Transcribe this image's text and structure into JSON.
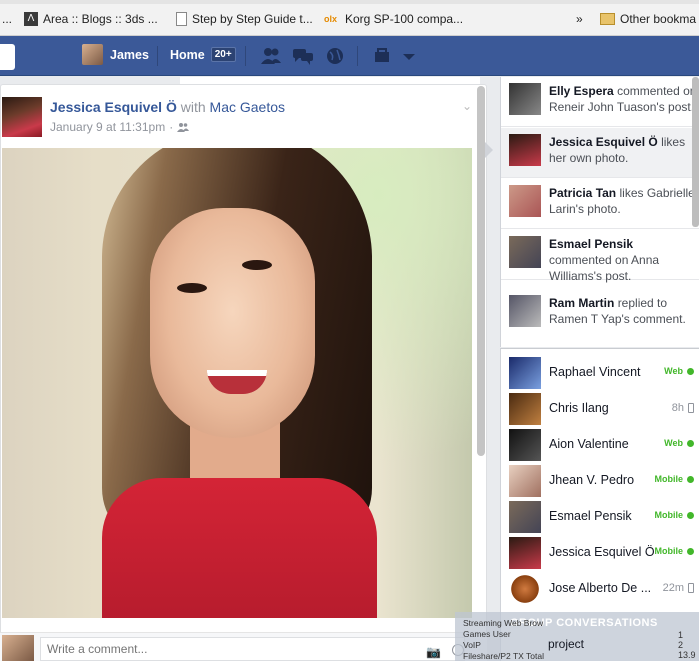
{
  "bookmarks": {
    "items": [
      {
        "label": "..."
      },
      {
        "label": "Area :: Blogs :: 3ds ..."
      },
      {
        "label": "Step by Step Guide t..."
      },
      {
        "label": "Korg SP-100 compa..."
      }
    ],
    "overflow": "»",
    "other": "Other bookma"
  },
  "topbar": {
    "user_name": "James",
    "home_label": "Home",
    "home_badge": "20+",
    "colors": {
      "brand": "#3b5998"
    }
  },
  "post": {
    "author": "Jessica Esquivel Ö",
    "with_text": "with",
    "tagged": "Mac Gaetos",
    "date": "January 9 at 11:31pm",
    "separator": "·",
    "audience_icon": "friends-icon"
  },
  "comment": {
    "placeholder": "Write a comment..."
  },
  "ticker": [
    {
      "name": "Elly Espera",
      "text": "commented on Reneir John Tuason's post."
    },
    {
      "name": "Jessica Esquivel Ö",
      "text": "likes her own photo."
    },
    {
      "name": "Patricia Tan",
      "text": "likes Gabrielle Larin's photo."
    },
    {
      "name": "Esmael Pensik",
      "text": "commented on Anna Williams's post."
    },
    {
      "name": "Ram Martin",
      "text": "replied to Ramen T Yap's comment."
    }
  ],
  "chat": [
    {
      "name": "Raphael Vincent",
      "status": "Web",
      "kind": "web"
    },
    {
      "name": "Chris Ilang",
      "status": "8h",
      "kind": "time"
    },
    {
      "name": "Aion Valentine",
      "status": "Web",
      "kind": "web"
    },
    {
      "name": "Jhean V. Pedro",
      "status": "Mobile",
      "kind": "mobile"
    },
    {
      "name": "Esmael Pensik",
      "status": "Mobile",
      "kind": "mobile"
    },
    {
      "name": "Jessica Esquivel Ö",
      "status": "Mobile",
      "kind": "mobile"
    },
    {
      "name": "Jose Alberto De ...",
      "status": "22m",
      "kind": "time"
    }
  ],
  "overlay": {
    "group_conversations": "GROUP CONVERSATIONS",
    "project": "project",
    "net_lines": [
      "Streaming",
      "Games",
      "VoIP",
      "Fileshare/P2"
    ],
    "net_lines_right": [
      "Web Brow",
      "User",
      "",
      "TX Total"
    ],
    "corner": [
      "1",
      "2",
      "13.9"
    ]
  }
}
